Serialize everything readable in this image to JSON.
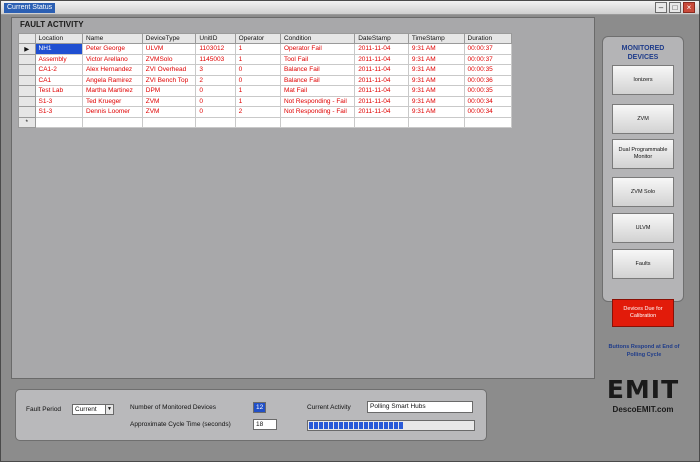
{
  "window": {
    "title": "Current Status"
  },
  "fault_activity": {
    "title": "FAULT ACTIVITY",
    "columns": [
      "Location",
      "Name",
      "DeviceType",
      "UnitID",
      "Operator",
      "Condition",
      "DateStamp",
      "TimeStamp",
      "Duration"
    ],
    "rows": [
      [
        "NH1",
        "Peter George",
        "ULVM",
        "1103012",
        "1",
        "Operator Fail",
        "2011-11-04",
        "9:31 AM",
        "00:00:37"
      ],
      [
        "Assembly",
        "Victor Arellano",
        "ZVMSolo",
        "1145003",
        "1",
        "Tool Fail",
        "2011-11-04",
        "9:31 AM",
        "00:00:37"
      ],
      [
        "CA1-2",
        "Alex Hernandez",
        "ZVI Overhead",
        "3",
        "0",
        "Balance Fail",
        "2011-11-04",
        "9:31 AM",
        "00:00:35"
      ],
      [
        "CA1",
        "Angela Ramirez",
        "ZVI Bench Top",
        "2",
        "0",
        "Balance Fail",
        "2011-11-04",
        "9:31 AM",
        "00:00:36"
      ],
      [
        "Test Lab",
        "Martha Martinez",
        "DPM",
        "0",
        "1",
        "Mat Fail",
        "2011-11-04",
        "9:31 AM",
        "00:00:35"
      ],
      [
        "S1-3",
        "Ted Krueger",
        "ZVM",
        "0",
        "1",
        "Not Responding - Fail",
        "2011-11-04",
        "9:31 AM",
        "00:00:34"
      ],
      [
        "S1-3",
        "Dennis Loomer",
        "ZVM",
        "0",
        "2",
        "Not Responding - Fail",
        "2011-11-04",
        "9:31 AM",
        "00:00:34"
      ]
    ],
    "new_row_marker": "*",
    "current_row_marker": "▶"
  },
  "monitored_devices": {
    "title_line1": "MONITORED",
    "title_line2": "DEVICES",
    "buttons": [
      "Ionizers",
      "ZVM",
      "Dual Programmable Monitor",
      "ZVM Solo",
      "ULVM",
      "Faults"
    ]
  },
  "calibration_button": "Devices Due for Calibration",
  "note": "Buttons Respond at End of Polling Cycle",
  "brand": {
    "logo": "EMIT",
    "url": "DescoEMIT.com"
  },
  "status_bar": {
    "fault_period_label": "Fault Period",
    "fault_period_value": "Current",
    "monitored_label": "Number of Monitored Devices",
    "monitored_value": "12",
    "cycle_label": "Approximate Cycle Time (seconds)",
    "cycle_value": "18",
    "activity_label": "Current Activity",
    "activity_value": "Polling Smart Hubs",
    "progress_fraction": 0.58
  },
  "colors": {
    "fault_text": "#e00000",
    "selection": "#1f4fd1",
    "accent_blue": "#1f3c8a",
    "calibration": "#e21b0a"
  }
}
